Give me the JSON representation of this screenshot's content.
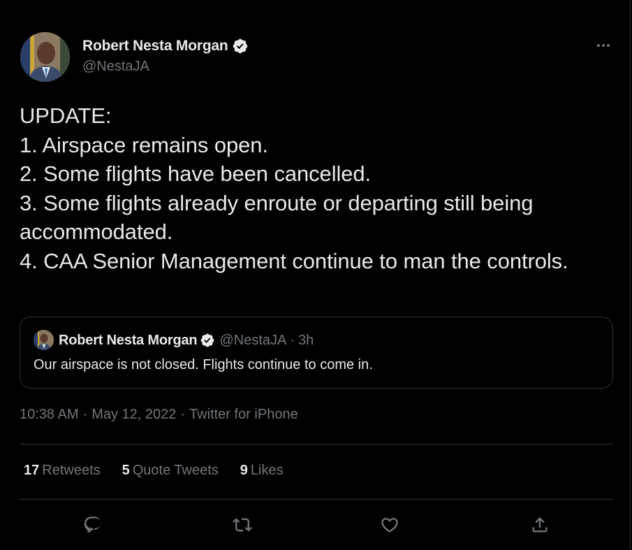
{
  "author": {
    "display_name": "Robert Nesta Morgan",
    "handle": "@NestaJA",
    "verified": true,
    "avatar_icon": "profile-photo-icon"
  },
  "tweet": {
    "text": "UPDATE:\n1. Airspace remains open.\n2. Some flights have been cancelled.\n3. Some flights already enroute or departing still being accommodated.\n4. CAA Senior Management continue to man the controls."
  },
  "quoted_tweet": {
    "display_name": "Robert Nesta Morgan",
    "handle": "@NestaJA",
    "separator": "·",
    "time": "3h",
    "text": "Our airspace is not closed. Flights continue to come in."
  },
  "meta": {
    "time": "10:38 AM",
    "separator": "·",
    "date": "May 12, 2022",
    "source": "Twitter for iPhone"
  },
  "stats": {
    "retweets_count": "17",
    "retweets_label": "Retweets",
    "quotes_count": "5",
    "quotes_label": "Quote Tweets",
    "likes_count": "9",
    "likes_label": "Likes"
  },
  "actions": [
    "reply-icon",
    "retweet-icon",
    "like-icon",
    "share-icon"
  ],
  "colors": {
    "background": "#000000",
    "text_primary": "#e7e9ea",
    "text_secondary": "#71767b",
    "border": "#2f3336",
    "verified_badge": "#e7e9ea"
  }
}
